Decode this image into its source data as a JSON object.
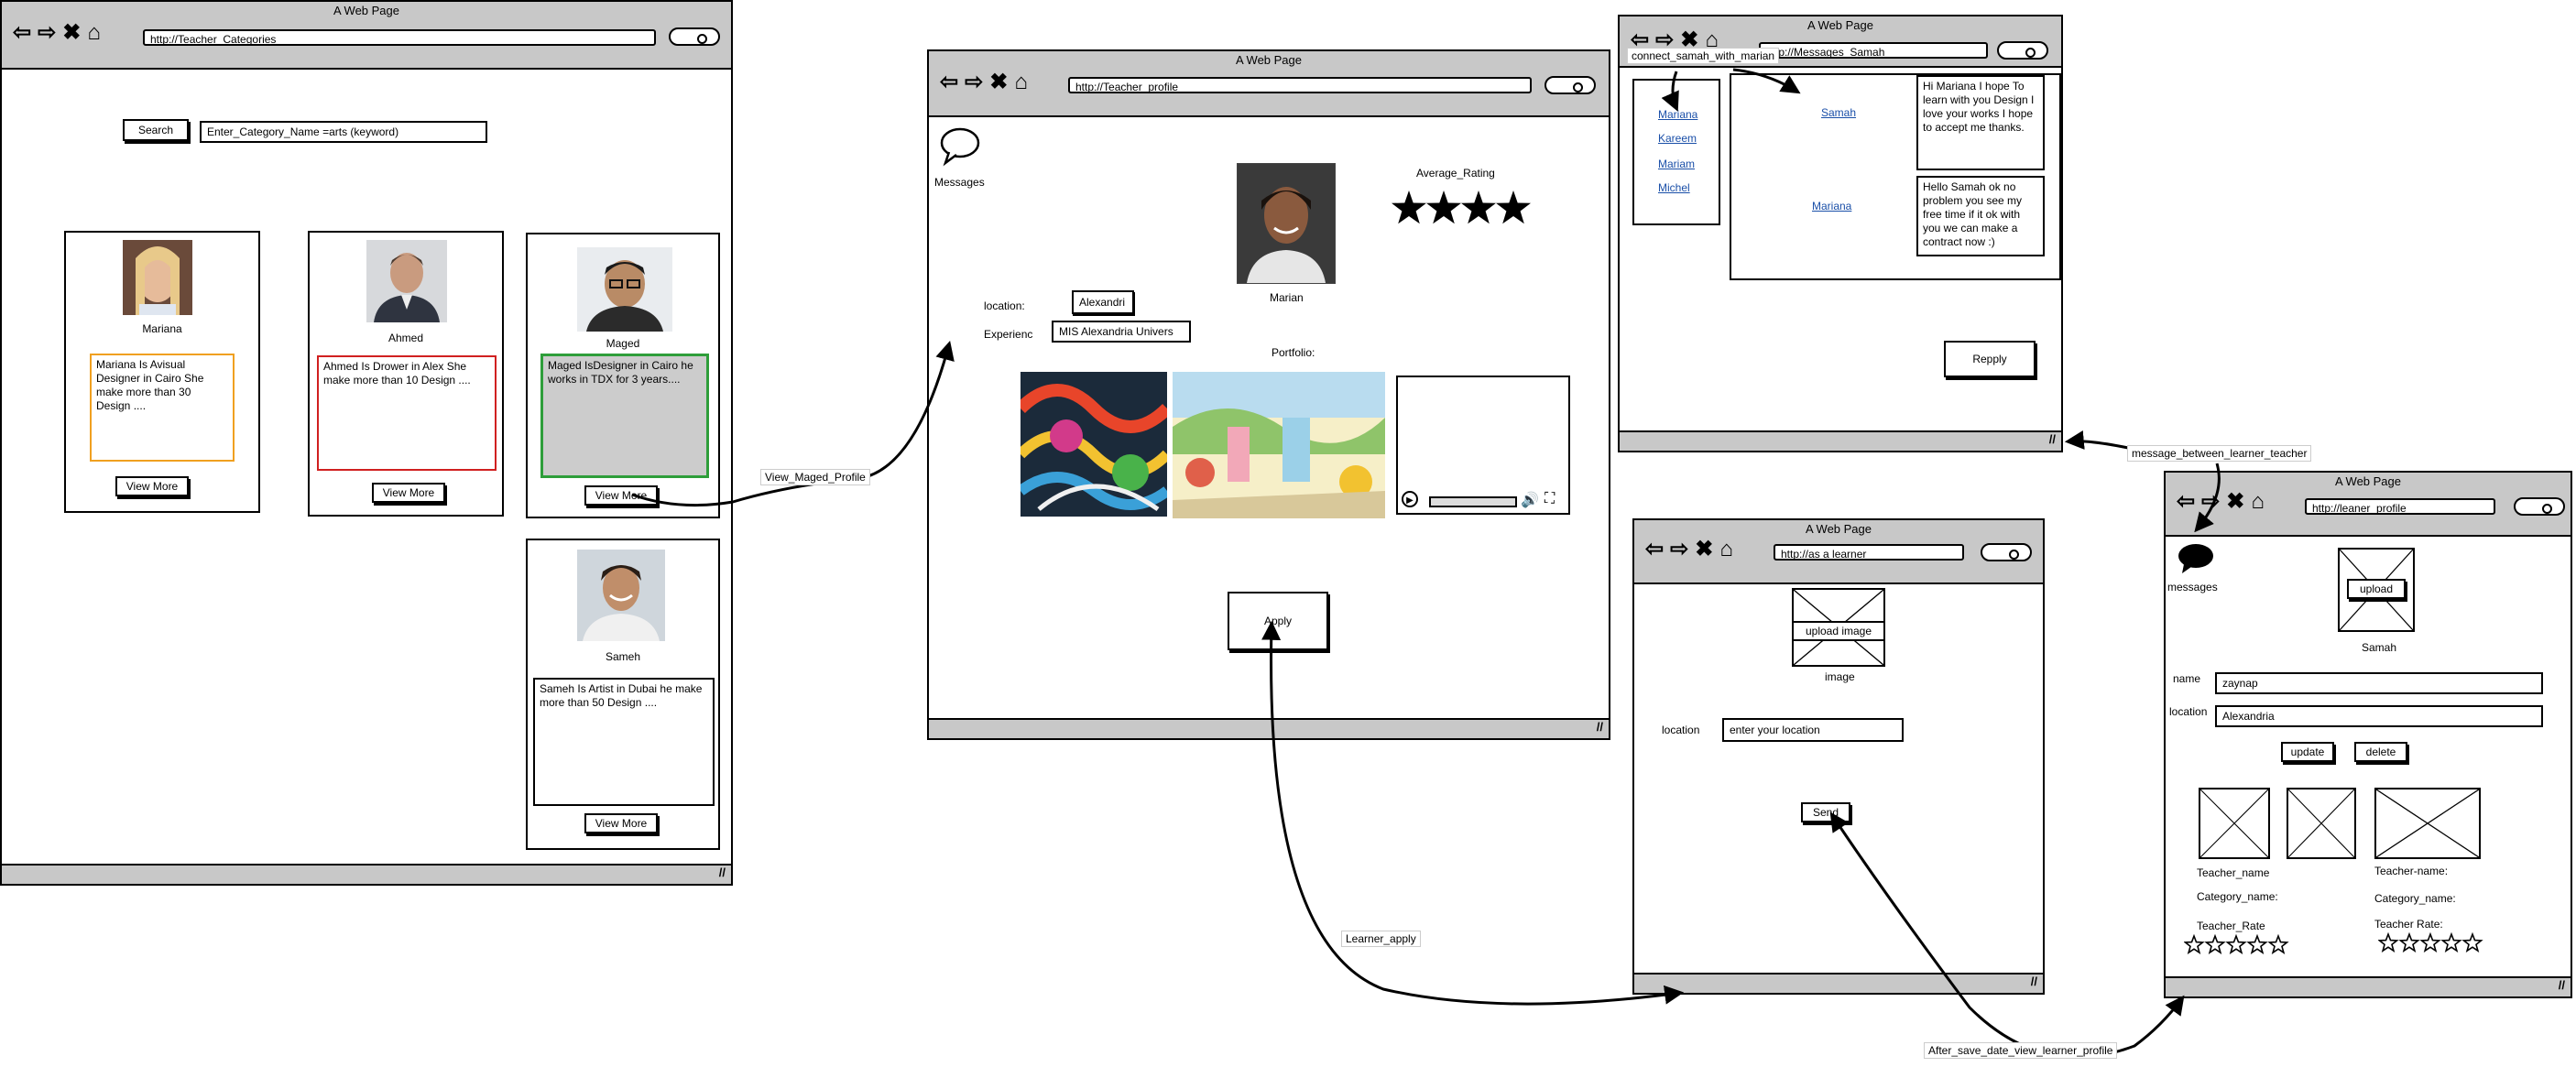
{
  "window_title": "A Web Page",
  "categories_page": {
    "url": "http://Teacher_Categories",
    "search_button": "Search",
    "search_value": "Enter_Category_Name =arts (keyword)",
    "view_more": "View More",
    "teachers": [
      {
        "name": "Mariana",
        "description": "Mariana  Is Avisual Designer  in Cairo She make more than 30 Design ....",
        "border": "#f0a020",
        "fill": "#ffffff"
      },
      {
        "name": "Ahmed",
        "description": "Ahmed Is Drower  in Alex She make more than 10 Design ....",
        "border": "#d02020",
        "fill": "#ffffff"
      },
      {
        "name": "Maged",
        "description": "Maged  IsDesigner   in Cairo he works in TDX for 3 years....",
        "border": "#2e9e3a",
        "fill": "#cccccc"
      },
      {
        "name": "Sameh",
        "description": "Sameh  Is Artist  in Dubai he make more than 50 Design ....",
        "border": "#000000",
        "fill": "#ffffff"
      }
    ]
  },
  "profile_page": {
    "url": "http://Teacher_profile",
    "messages_label": "Messages",
    "teacher_name": "Marian",
    "rating_label": "Average_Rating",
    "rating_stars": 4,
    "location_label": "location:",
    "location_value": "Alexandri",
    "experience_label": "Experienc",
    "experience_value": "MIS Alexandria Univers",
    "portfolio_label": "Portfolio:",
    "apply_button": "Apply"
  },
  "messages_page": {
    "url": "http://Messages_Samah",
    "contacts": [
      "Mariana",
      "Kareem",
      "Mariam",
      "Michel"
    ],
    "thread": [
      {
        "sender": "Samah",
        "text": "Hi Mariana I hope To learn with you Design I love your works  I  hope to accept me thanks."
      },
      {
        "sender": "Mariana",
        "text": "Hello Samah ok no problem you see my free time if it ok with you we can make a contract now :)"
      }
    ],
    "reply_button": "Repply"
  },
  "learner_page": {
    "url": "http://as a learner",
    "upload_button": "upload image",
    "image_label": "image",
    "location_label": "location",
    "location_placeholder": "enter your location",
    "send_button": "Send"
  },
  "learner_profile_page": {
    "url": "http://leaner_profile",
    "messages_label": "messages",
    "upload_button": "upload",
    "learner_name": "Samah",
    "name_label": "name",
    "name_value": "zaynap",
    "location_label": "location",
    "location_value": "Alexandria",
    "update_button": "update",
    "delete_button": "delete",
    "teachers": [
      {
        "teacher_label": "Teacher_name",
        "category_label": "Category_name:",
        "rate_label": "Teacher_Rate",
        "stars": 5
      },
      {
        "teacher_label": "Teacher-name:",
        "category_label": "Category_name:",
        "rate_label": "Teacher Rate:",
        "stars": 5
      }
    ]
  },
  "flow_labels": {
    "view_profile": "View_Maged_Profile",
    "connect": "connect_samah_with_marian",
    "message_between": "message_between_learner_teacher",
    "learner_apply": "Learner_apply",
    "after_save": "After_save_date_view_learner_profile"
  }
}
